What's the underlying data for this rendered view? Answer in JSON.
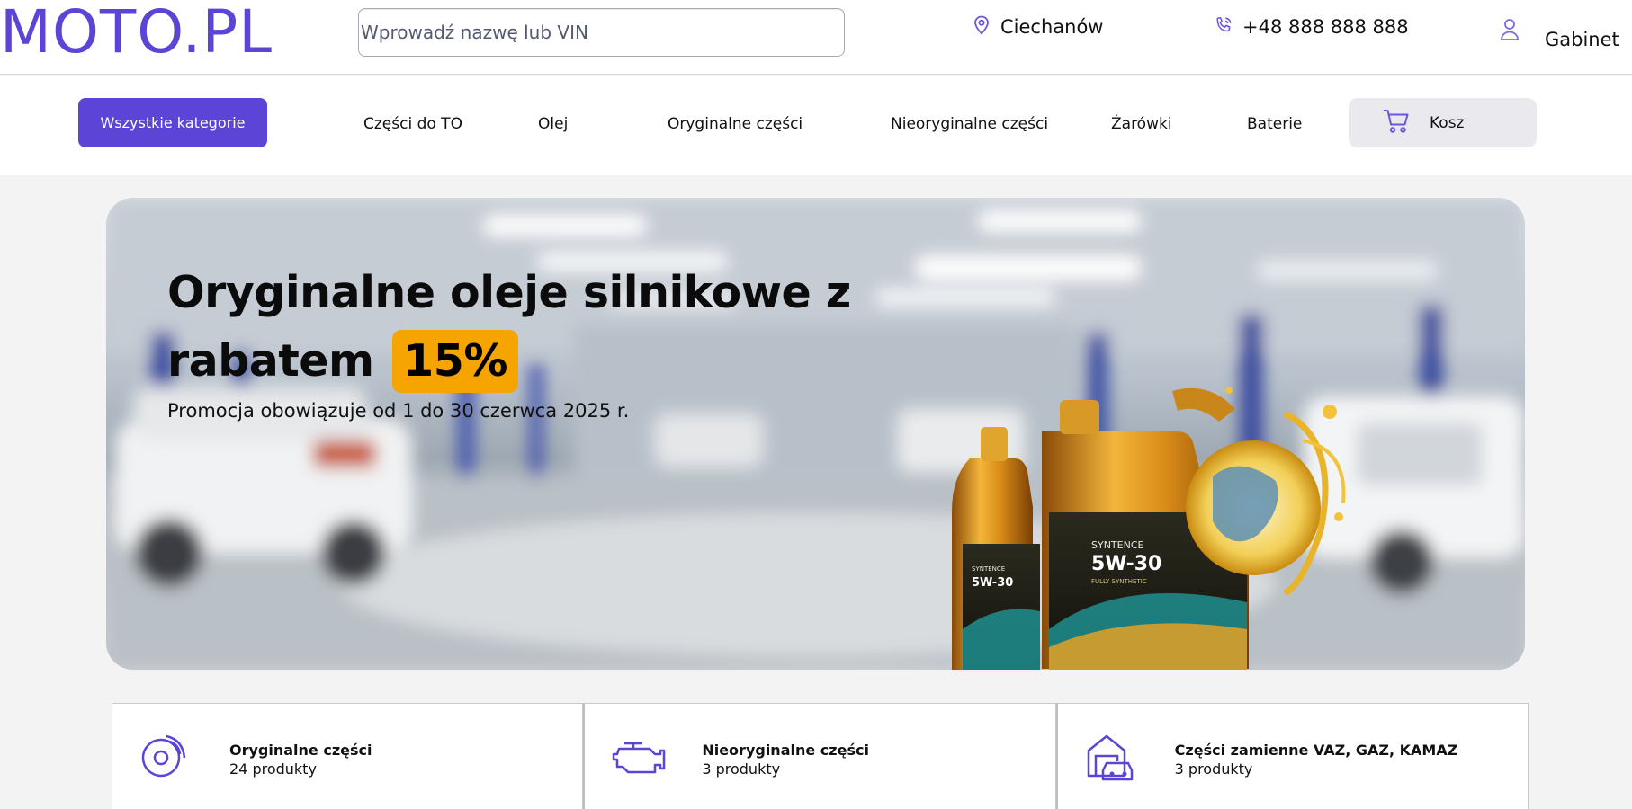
{
  "header": {
    "logo": "MOTO.PL",
    "search_placeholder": "Wprowadź nazwę lub VIN",
    "location": "Ciechanów",
    "phone": "+48 888 888 888",
    "account_label": "Gabinet",
    "icons": {
      "location": "map-pin-icon",
      "phone": "phone-icon",
      "account": "user-icon"
    }
  },
  "nav": {
    "all_categories": "Wszystkie kategorie",
    "links": [
      "Części do TO",
      "Olej",
      "Oryginalne części",
      "Nieoryginalne części",
      "Żarówki",
      "Baterie"
    ],
    "cart_label": "Kosz",
    "cart_icon": "cart-icon"
  },
  "hero": {
    "title_part1": "Oryginalne oleje silnikowe z rabatem",
    "discount": "15%",
    "subtitle": "Promocja obowiązuje od 1 do 30 czerwca 2025 r.",
    "product_labels": {
      "brand": "SYNTENCE",
      "viscosity": "5W-30",
      "type": "FULLY SYNTHETIC"
    }
  },
  "categories": [
    {
      "title": "Oryginalne części",
      "count": "24 produkty",
      "icon": "brake-disc-icon"
    },
    {
      "title": "Nieoryginalne części",
      "count": "3 produkty",
      "icon": "engine-icon"
    },
    {
      "title": "Części zamienne VAZ, GAZ, KAMAZ",
      "count": "3 produkty",
      "icon": "garage-car-icon"
    }
  ],
  "colors": {
    "brand": "#5b44d6",
    "badge": "#f6a400",
    "cart_bg": "#e9e9ee"
  }
}
